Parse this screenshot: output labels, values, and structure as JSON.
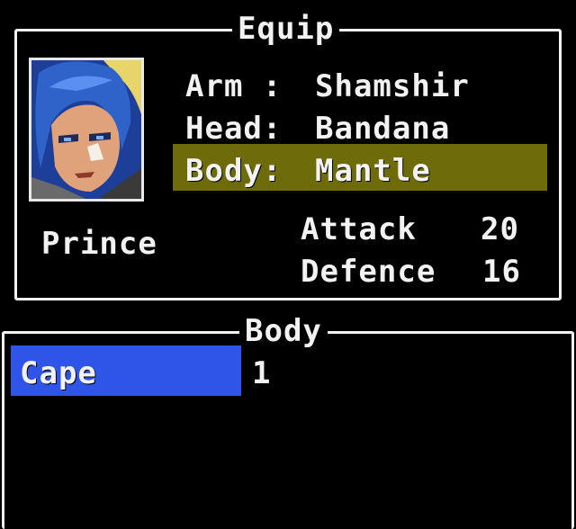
{
  "equip_panel": {
    "title": "Equip",
    "character_name": "Prince",
    "slots": [
      {
        "label": "Arm :",
        "value": "Shamshir"
      },
      {
        "label": "Head:",
        "value": "Bandana"
      },
      {
        "label": "Body:",
        "value": "Mantle"
      }
    ],
    "stats": [
      {
        "label": "Attack",
        "value": "20"
      },
      {
        "label": "Defence",
        "value": "16"
      }
    ]
  },
  "item_panel": {
    "title": "Body",
    "items": [
      {
        "name": "Cape",
        "count": "1"
      }
    ]
  },
  "colors": {
    "background": "#000000",
    "text": "#f2f2f2",
    "selected_slot": "#6d6b0a",
    "selected_item": "#2f55e8"
  },
  "icons": [
    "character-portrait"
  ]
}
